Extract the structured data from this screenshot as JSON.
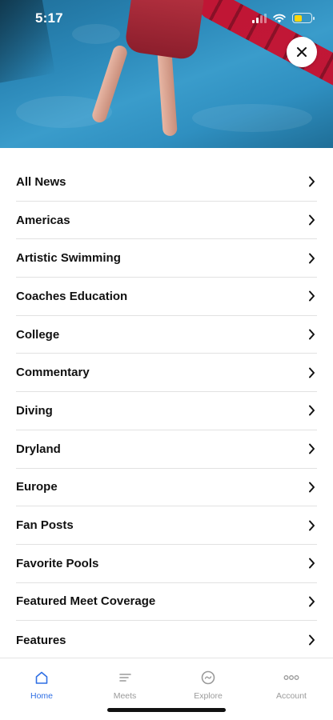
{
  "status_bar": {
    "time": "5:17"
  },
  "hero": {
    "close_icon": "close-icon"
  },
  "menu": {
    "items": [
      {
        "label": "All News"
      },
      {
        "label": "Americas"
      },
      {
        "label": "Artistic Swimming"
      },
      {
        "label": "Coaches Education"
      },
      {
        "label": "College"
      },
      {
        "label": "Commentary"
      },
      {
        "label": "Diving"
      },
      {
        "label": "Dryland"
      },
      {
        "label": "Europe"
      },
      {
        "label": "Fan Posts"
      },
      {
        "label": "Favorite Pools"
      },
      {
        "label": "Featured Meet Coverage"
      },
      {
        "label": "Features"
      }
    ],
    "chevron_icon": "chevron-right-icon"
  },
  "tabbar": {
    "tabs": [
      {
        "label": "Home",
        "icon": "home-icon",
        "active": true
      },
      {
        "label": "Meets",
        "icon": "list-icon",
        "active": false
      },
      {
        "label": "Explore",
        "icon": "explore-icon",
        "active": false
      },
      {
        "label": "Account",
        "icon": "more-icon",
        "active": false
      }
    ]
  },
  "colors": {
    "accent": "#2f6fe4",
    "inactive": "#9a9a9a",
    "battery": "#ffd60a"
  }
}
